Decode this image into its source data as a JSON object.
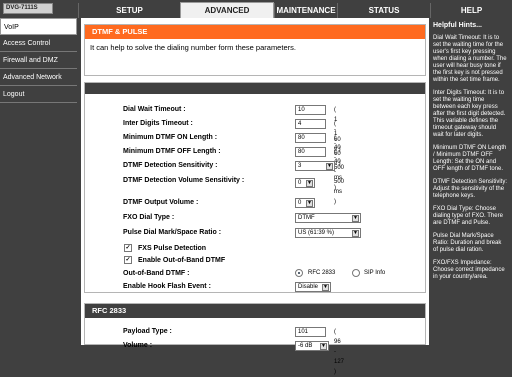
{
  "top": {
    "model": "DVG-7111S",
    "tabs": [
      "SETUP",
      "ADVANCED",
      "MAINTENANCE",
      "STATUS",
      "HELP"
    ]
  },
  "sidebar": {
    "items": [
      {
        "label": "VoIP",
        "active": true
      },
      {
        "label": "Access Control"
      },
      {
        "label": "Firewall and DMZ"
      },
      {
        "label": "Advanced Network"
      },
      {
        "label": "Logout"
      }
    ]
  },
  "dtmf": {
    "title": "DTMF & PULSE",
    "description": "It can help to solve the dialing number form these parameters.",
    "dial_wait_timeout": {
      "label": "Dial Wait Timeout :",
      "value": "10",
      "hint": "( 1 - 60 s )"
    },
    "inter_digits_timeout": {
      "label": "Inter Digits Timeout :",
      "value": "4",
      "hint": "( 1 - 60 s )"
    },
    "min_on": {
      "label": "Minimum DTMF ON Length :",
      "value": "80",
      "hint": "( 40 - 500 ms )"
    },
    "min_off": {
      "label": "Minimum DTMF OFF Length :",
      "value": "80",
      "hint": "( 40 - 500 ms )"
    },
    "sensitivity": {
      "label": "DTMF Detection Sensitivity :",
      "value": "3"
    },
    "volume_sensitivity": {
      "label": "DTMF Detection Volume Sensitivity :",
      "value": "0"
    },
    "output_volume": {
      "label": "DTMF Output Volume :",
      "value": "0"
    },
    "fxo_dial_type": {
      "label": "FXO Dial Type :",
      "value": "DTMF"
    },
    "pulse_ratio": {
      "label": "Pulse Dial Mark/Space Ratio :",
      "value": "US (61:39 %)"
    },
    "fxs_pulse": {
      "label": "FXS Pulse Detection",
      "checked": true
    },
    "oob": {
      "label": "Enable Out-of-Band DTMF",
      "checked": true
    },
    "oob_dtmf": {
      "label": "Out-of-Band DTMF :",
      "options": [
        "RFC 2833",
        "SIP Info"
      ],
      "selected": "RFC 2833"
    },
    "hook_flash": {
      "label": "Enable Hook Flash Event :",
      "value": "Disable"
    }
  },
  "rfc2833": {
    "title": "RFC 2833",
    "payload_type": {
      "label": "Payload Type :",
      "value": "101",
      "hint": "( 96 - 127 )"
    },
    "volume": {
      "label": "Volume :",
      "value": "-6 dB"
    }
  },
  "help": {
    "title": "Helpful Hints...",
    "paragraphs": [
      "Dial Wait Timeout: It is to set the waiting time for the user's first key pressing when dialing a number. The user will hear busy tone if the first key is not pressed within the set time frame.",
      "Inter Digits Timeout: It is to set the waiting time between each key press after the first digit detected. This variable defines the timeout gateway should wait for later digits.",
      "Minimum DTMF ON Length / Minimum DTMF OFF Length: Set the ON and OFF length of DTMF tone.",
      "DTMF Detection Sensitivity: Adjust the sensitivity of the telephone keys.",
      "FXO Dial Type: Choose dialing type of FXO. There are DTMF and Pulse.",
      "Pulse Dial Mark/Space Ratio: Duration and break of pulse dial ration.",
      "FXO/FXS Impedance: Choose correct impedance in your country/area."
    ]
  }
}
